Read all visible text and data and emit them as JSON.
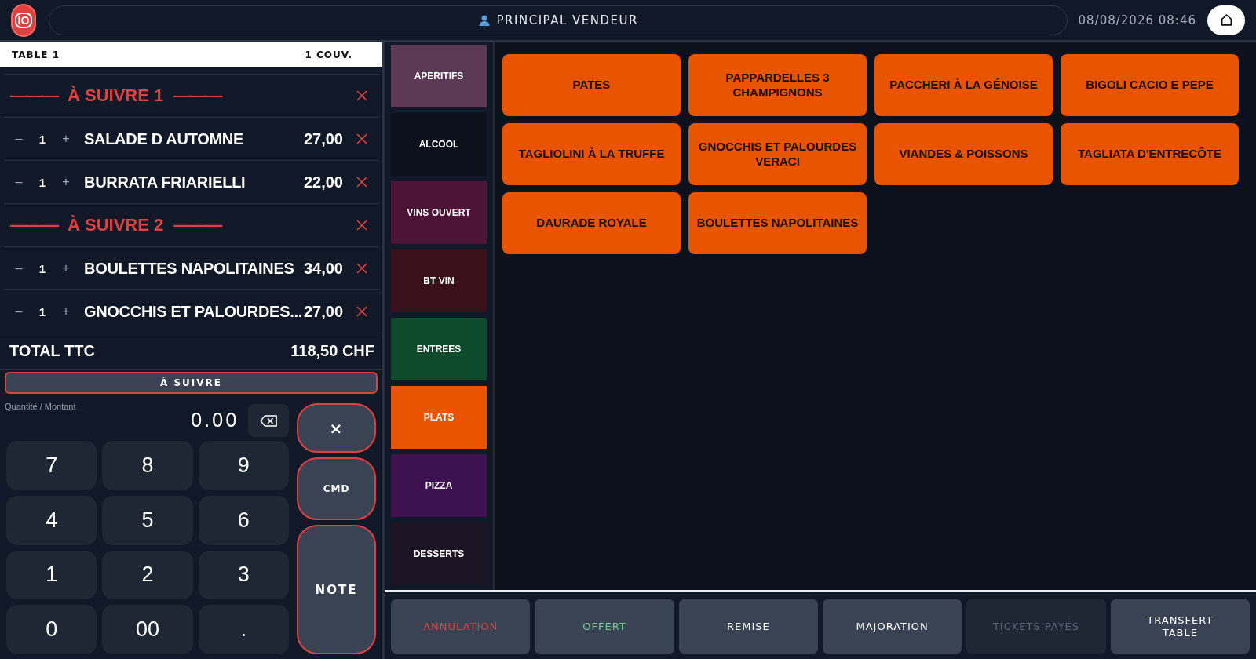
{
  "header": {
    "logo_text": "IO",
    "user": "PRINCIPAL VENDEUR",
    "datetime": "08/08/2026 08:46"
  },
  "ticket": {
    "table": "TABLE 1",
    "covers": "1 COUV.",
    "lines": [
      {
        "kind": "course",
        "label": "À SUIVRE 1",
        "dashes": "———"
      },
      {
        "kind": "item",
        "minus": "–",
        "qty": "1",
        "plus": "+",
        "name": "SALADE D AUTOMNE",
        "price": "27,00"
      },
      {
        "kind": "item",
        "minus": "–",
        "qty": "1",
        "plus": "+",
        "name": "BURRATA FRIARIELLI",
        "price": "22,00"
      },
      {
        "kind": "course",
        "label": "À SUIVRE 2",
        "dashes": "———"
      },
      {
        "kind": "item",
        "minus": "–",
        "qty": "1",
        "plus": "+",
        "name": "BOULETTES NAPOLITAINES",
        "price": "34,00"
      },
      {
        "kind": "item",
        "minus": "–",
        "qty": "1",
        "plus": "+",
        "name": "GNOCCHIS ET PALOURDES...",
        "price": "27,00"
      }
    ],
    "total_label": "TOTAL TTC",
    "total": "118,50 CHF"
  },
  "follow_button": "À SUIVRE",
  "entry": {
    "label": "Quantité / Montant",
    "value": "0.00"
  },
  "keys": [
    "7",
    "8",
    "9",
    "4",
    "5",
    "6",
    "1",
    "2",
    "3",
    "0",
    "00",
    "."
  ],
  "side_buttons": [
    {
      "label": "×",
      "kind": "icon"
    },
    {
      "label": "CMD",
      "kind": "small"
    },
    {
      "label": "NOTE",
      "kind": "tall"
    }
  ],
  "categories": [
    {
      "label": "APERITIFS",
      "color": "#5c3a55"
    },
    {
      "label": "ALCOOL",
      "color": "#0c111b"
    },
    {
      "label": "VINS OUVERT",
      "color": "#4d1437"
    },
    {
      "label": "BT VIN",
      "color": "#3a111b"
    },
    {
      "label": "ENTREES",
      "color": "#0f4a2c"
    },
    {
      "label": "PLATS",
      "color": "#e85400"
    },
    {
      "label": "PIZZA",
      "color": "#3e1250"
    },
    {
      "label": "DESSERTS",
      "color": "#1d1424"
    }
  ],
  "products": [
    "PATES",
    "PAPPARDELLES 3 CHAMPIGNONS",
    "PACCHERI À LA GÉNOISE",
    "BIGOLI CACIO E PEPE",
    "TAGLIOLINI À LA TRUFFE",
    "GNOCCHIS ET PALOURDES VERACI",
    "VIANDES & POISSONS",
    "TAGLIATA D'ENTRECÔTE",
    "DAURADE ROYALE",
    "BOULETTES NAPOLITAINES"
  ],
  "actions": [
    {
      "label": "ANNULATION",
      "kind": "danger",
      "disabled": false
    },
    {
      "label": "OFFERT",
      "kind": "success",
      "disabled": false
    },
    {
      "label": "REMISE",
      "kind": "plain",
      "disabled": false
    },
    {
      "label": "MAJORATION",
      "kind": "plain",
      "disabled": false
    },
    {
      "label": "TICKETS PAYÉS",
      "kind": "plain",
      "disabled": true
    },
    {
      "label": "TRANSFERT TABLE",
      "kind": "plain",
      "disabled": false
    }
  ]
}
